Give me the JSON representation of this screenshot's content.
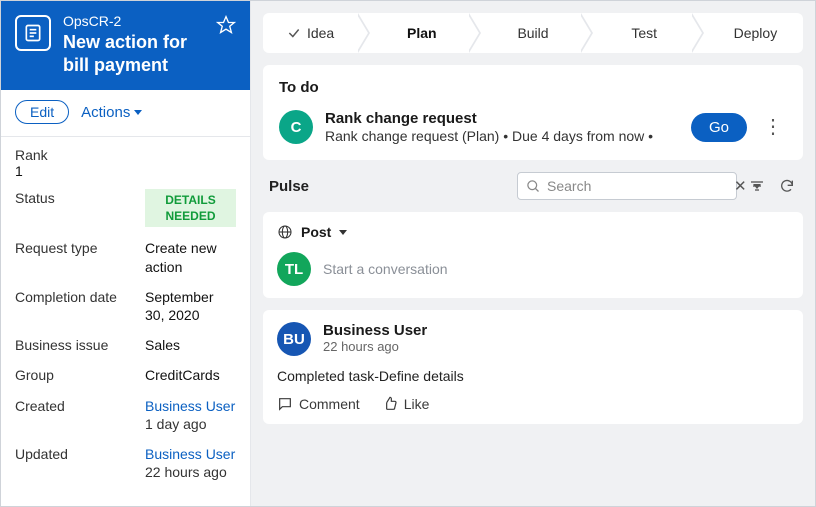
{
  "case": {
    "id": "OpsCR-2",
    "title": "New action for bill payment"
  },
  "actions": {
    "edit": "Edit",
    "menu": "Actions"
  },
  "meta": {
    "rank_label": "Rank",
    "rank_value": "1",
    "status_label": "Status",
    "status_value": "DETAILS NEEDED",
    "request_type_label": "Request type",
    "request_type_value": "Create new action",
    "completion_label": "Completion date",
    "completion_value": "September 30, 2020",
    "issue_label": "Business issue",
    "issue_value": "Sales",
    "group_label": "Group",
    "group_value": "CreditCards",
    "created_label": "Created",
    "created_user": "Business User",
    "created_when": "1 day ago",
    "updated_label": "Updated",
    "updated_user": "Business User",
    "updated_when": "22 hours ago"
  },
  "stages": {
    "s0": "Idea",
    "s1": "Plan",
    "s2": "Build",
    "s3": "Test",
    "s4": "Deploy"
  },
  "todo": {
    "heading": "To do",
    "avatar": "C",
    "name": "Rank change request",
    "sub": "Rank change request (Plan)  •  Due 4 days from now  •",
    "go": "Go"
  },
  "pulse": {
    "title": "Pulse",
    "search_placeholder": "Search",
    "post_label": "Post",
    "compose_avatar": "TL",
    "compose_placeholder": "Start a conversation"
  },
  "post": {
    "avatar": "BU",
    "author": "Business User",
    "time": "22 hours ago",
    "body": "Completed task-Define details",
    "comment": "Comment",
    "like": "Like"
  }
}
